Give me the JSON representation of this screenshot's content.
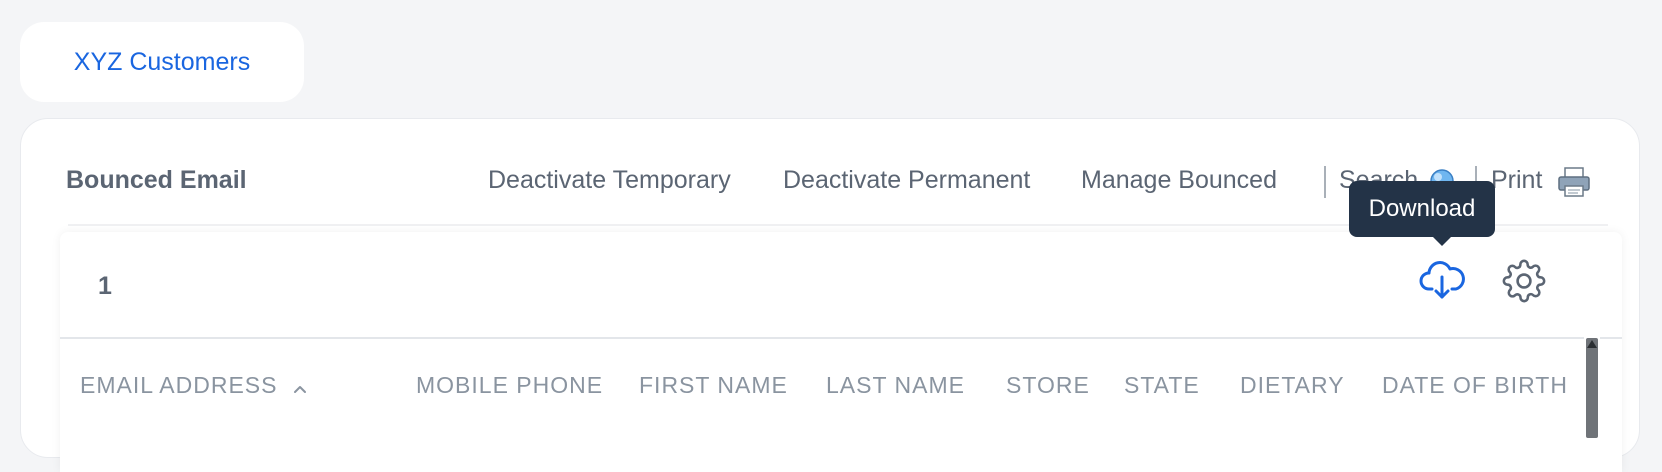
{
  "page_tab": {
    "label": "XYZ Customers"
  },
  "section": {
    "title": "Bounced Email"
  },
  "toolbar": {
    "deactivate_temporary": "Deactivate Temporary",
    "deactivate_permanent": "Deactivate Permanent",
    "manage_bounced": "Manage Bounced",
    "search": "Search",
    "print": "Print"
  },
  "table": {
    "row_count": "1",
    "download_tooltip": "Download",
    "columns": [
      "EMAIL ADDRESS",
      "MOBILE PHONE",
      "FIRST NAME",
      "LAST NAME",
      "STORE",
      "STATE",
      "DIETARY",
      "DATE OF BIRTH"
    ],
    "sorted_column": "EMAIL ADDRESS",
    "sort_direction": "ascending"
  },
  "icons": {
    "search": "search-globe-icon",
    "print": "printer-icon",
    "download": "cloud-download-icon",
    "settings": "gear-icon",
    "sort": "chevron-up-icon"
  },
  "colors": {
    "accent": "#1a66e0",
    "text": "#5b6573",
    "header_text": "#8a94a0",
    "tooltip_bg": "#233347",
    "page_bg": "#f4f5f7"
  }
}
